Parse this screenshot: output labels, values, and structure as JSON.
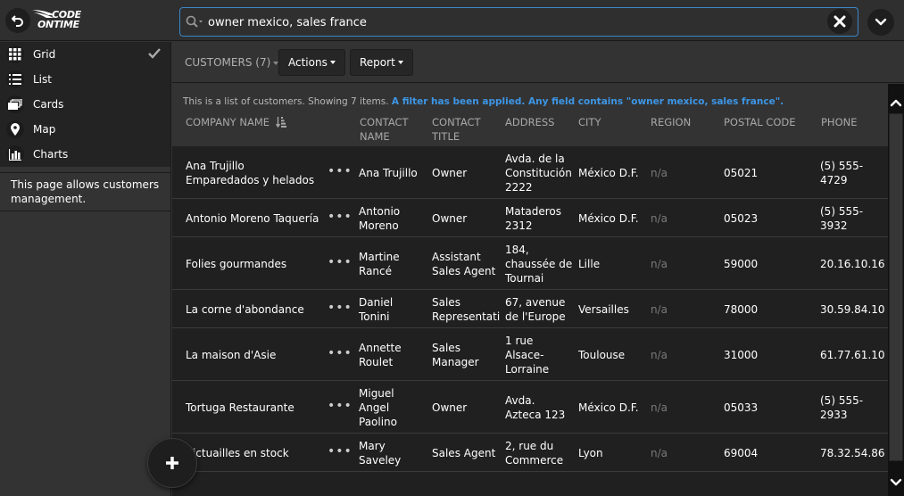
{
  "app": {
    "logo_line1": "CODE",
    "logo_line2": "ONTIME"
  },
  "search": {
    "value": "owner mexico, sales france",
    "placeholder": ""
  },
  "sidebar": {
    "views": [
      {
        "label": "Grid",
        "icon": "grid-icon",
        "selected": true
      },
      {
        "label": "List",
        "icon": "list-icon",
        "selected": false
      },
      {
        "label": "Cards",
        "icon": "cards-icon",
        "selected": false
      },
      {
        "label": "Map",
        "icon": "map-pin-icon",
        "selected": false
      },
      {
        "label": "Charts",
        "icon": "bar-chart-icon",
        "selected": false
      }
    ],
    "description": "This page allows customers management."
  },
  "toolbar": {
    "breadcrumb": "CUSTOMERS (7)",
    "actions_label": "Actions",
    "report_label": "Report"
  },
  "grid": {
    "info": "This is a list of customers. Showing 7 items.",
    "filter_info": "A filter has been applied. Any field contains \"owner mexico, sales france\".",
    "columns": [
      {
        "line1": "COMPANY NAME",
        "line2": ""
      },
      {
        "line1": "CONTACT",
        "line2": "NAME"
      },
      {
        "line1": "CONTACT",
        "line2": "TITLE"
      },
      {
        "line1": "ADDRESS",
        "line2": ""
      },
      {
        "line1": "CITY",
        "line2": ""
      },
      {
        "line1": "REGION",
        "line2": ""
      },
      {
        "line1": "POSTAL CODE",
        "line2": ""
      },
      {
        "line1": "PHONE",
        "line2": ""
      }
    ],
    "rows": [
      {
        "company": "Ana Trujillo Emparedados y helados",
        "contact": "Ana Trujillo",
        "title": "Owner",
        "address": "Avda. de la Constitución 2222",
        "city": "México D.F.",
        "region": "n/a",
        "postal": "05021",
        "phone": "(5) 555-4729"
      },
      {
        "company": "Antonio Moreno Taquería",
        "contact": "Antonio Moreno",
        "title": "Owner",
        "address": "Mataderos 2312",
        "city": "México D.F.",
        "region": "n/a",
        "postal": "05023",
        "phone": "(5) 555-3932"
      },
      {
        "company": "Folies gourmandes",
        "contact": "Martine Rancé",
        "title": "Assistant Sales Agent",
        "address": "184, chaussée de Tournai",
        "city": "Lille",
        "region": "n/a",
        "postal": "59000",
        "phone": "20.16.10.16"
      },
      {
        "company": "La corne d'abondance",
        "contact": "Daniel Tonini",
        "title": "Sales Representati",
        "address": "67, avenue de l'Europe",
        "city": "Versailles",
        "region": "n/a",
        "postal": "78000",
        "phone": "30.59.84.10"
      },
      {
        "company": "La maison d'Asie",
        "contact": "Annette Roulet",
        "title": "Sales Manager",
        "address": "1 rue Alsace-Lorraine",
        "city": "Toulouse",
        "region": "n/a",
        "postal": "31000",
        "phone": "61.77.61.10"
      },
      {
        "company": "Tortuga Restaurante",
        "contact": "Miguel Angel Paolino",
        "title": "Owner",
        "address": "Avda. Azteca 123",
        "city": "México D.F.",
        "region": "n/a",
        "postal": "05033",
        "phone": "(5) 555-2933"
      },
      {
        "company": "Victuailles en stock",
        "contact": "Mary Saveley",
        "title": "Sales Agent",
        "address": "2, rue du Commerce",
        "city": "Lyon",
        "region": "n/a",
        "postal": "69004",
        "phone": "78.32.54.86"
      }
    ],
    "more_label": "•••"
  },
  "colors": {
    "accent": "#3a86c8",
    "filter_text": "#3d96e6",
    "background": "#333333",
    "grid_background": "#202020"
  }
}
